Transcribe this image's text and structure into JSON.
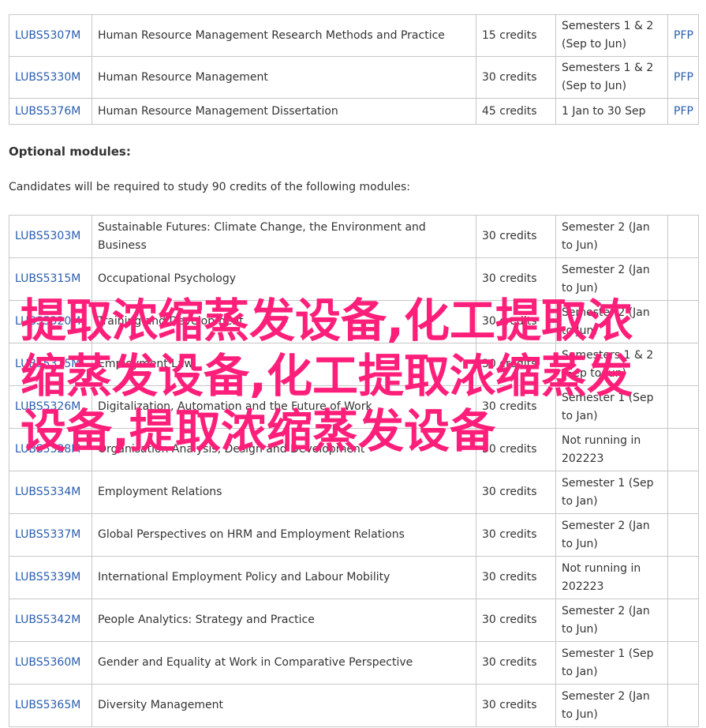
{
  "core_modules": [
    {
      "code": "LUBS5307M",
      "title": "Human Resource Management Research Methods and Practice",
      "credits": "15 credits",
      "semester": "Semesters 1 & 2 (Sep to Jun)",
      "pfp": "PFP"
    },
    {
      "code": "LUBS5330M",
      "title": "Human Resource Management",
      "credits": "30 credits",
      "semester": "Semesters 1 & 2 (Sep to Jun)",
      "pfp": "PFP"
    },
    {
      "code": "LUBS5376M",
      "title": "Human Resource Management Dissertation",
      "credits": "45 credits",
      "semester": "1 Jan to 30 Sep",
      "pfp": "PFP"
    }
  ],
  "optional": {
    "heading": "Optional modules:",
    "intro": "Candidates will be required to study 90 credits of the following modules:"
  },
  "optional_modules": [
    {
      "code": "LUBS5303M",
      "title": "Sustainable Futures: Climate Change, the Environment and Business",
      "credits": "30 credits",
      "semester": "Semester 2 (Jan to Jun)"
    },
    {
      "code": "LUBS5315M",
      "title": "Occupational Psychology",
      "credits": "30 credits",
      "semester": "Semester 2 (Jan to Jun)"
    },
    {
      "code": "LUBS5320M",
      "title": "Training and Development",
      "credits": "30 credits",
      "semester": "Semester 2 (Jan to Jun)"
    },
    {
      "code": "LUBS5325M",
      "title": "Employment Law",
      "credits": "30 credits",
      "semester": "Semesters 1 & 2 (Sep to Jun)"
    },
    {
      "code": "LUBS5326M",
      "title": "Digitalization, Automation and the Future of Work",
      "credits": "30 credits",
      "semester": "Semester 1 (Sep to Jan)"
    },
    {
      "code": "LUBS5328M",
      "title": "Organisation Analysis, Design and Development",
      "credits": "30 credits",
      "semester": "Not running in 202223"
    },
    {
      "code": "LUBS5334M",
      "title": "Employment Relations",
      "credits": "30 credits",
      "semester": "Semester 1 (Sep to Jan)"
    },
    {
      "code": "LUBS5337M",
      "title": "Global Perspectives on HRM and Employment Relations",
      "credits": "30 credits",
      "semester": "Semester 2 (Jan to Jun)"
    },
    {
      "code": "LUBS5339M",
      "title": "International Employment Policy and Labour Mobility",
      "credits": "30 credits",
      "semester": "Not running in 202223"
    },
    {
      "code": "LUBS5342M",
      "title": "People Analytics: Strategy and Practice",
      "credits": "30 credits",
      "semester": "Semester 2 (Jan to Jun)"
    },
    {
      "code": "LUBS5360M",
      "title": "Gender and Equality at Work in Comparative Perspective",
      "credits": "30 credits",
      "semester": "Semester 1 (Sep to Jan)"
    },
    {
      "code": "LUBS5365M",
      "title": "Diversity Management",
      "credits": "30 credits",
      "semester": "Semester 2 (Jan to Jun)"
    }
  ],
  "watermark": "提取浓缩蒸发设备,化工提取浓缩蒸发设备,化工提取浓缩蒸发设备,提取浓缩蒸发设备",
  "colors": {
    "link": "#2a5db0",
    "border": "#c7c7c7",
    "watermark": "#ff1f7a",
    "text": "#333333"
  }
}
